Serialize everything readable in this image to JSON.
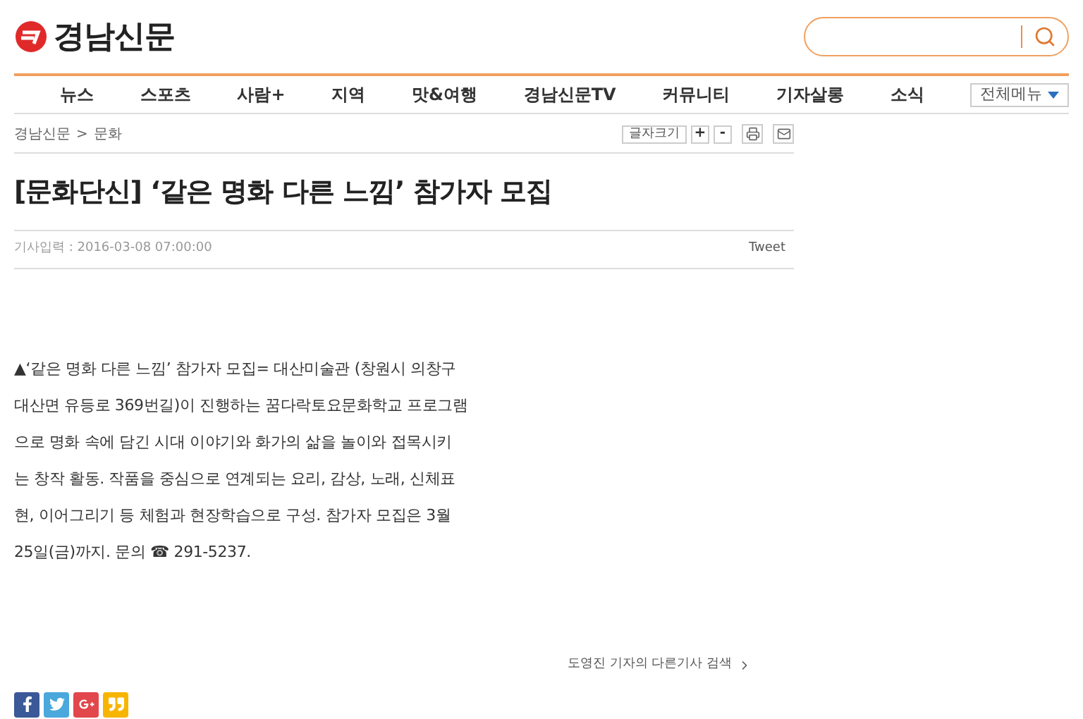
{
  "logo": {
    "text": "경남신문"
  },
  "nav": [
    "뉴스",
    "스포츠",
    "사람+",
    "지역",
    "맛&여행",
    "경남신문TV",
    "커뮤니티",
    "기자살롱",
    "소식"
  ],
  "all_menu": "전체메뉴",
  "breadcrumb": [
    "경남신문",
    "문화"
  ],
  "breadcrumb_separator": ">",
  "font_size": {
    "label": "글자크기",
    "increase": "+",
    "decrease": "-"
  },
  "headline": "[문화단신] ‘같은 명화 다른 느낌’ 참가자 모집",
  "date": "기사입력 : 2016-03-08 07:00:00",
  "tweet": "Tweet",
  "body_lines": [
    "▲‘같은 명화 다른 느낌’ 참가자 모집= 대산미술관 (창원시 의창구",
    "대산면 유등로 369번길)이 진행하는 꿈다락토요문화학교 프로그램",
    "으로 명화 속에 담긴 시대 이야기와 화가의 삶을 놀이와 접목시키",
    "는 창작 활동. 작품을 중심으로 연계되는 요리, 감상, 노래, 신체표",
    "현, 이어그리기 등 체험과 현장학습으로 구성. 참가자 모집은 3월",
    "25일(금)까지. 문의 ☎ 291-5237."
  ],
  "reporter_link": "도영진 기자의 다른기사 검색",
  "share": [
    {
      "kind": "facebook",
      "color": "#3b5998"
    },
    {
      "kind": "twitter",
      "color": "#4aa8dc"
    },
    {
      "kind": "google",
      "color": "#e2474b"
    },
    {
      "kind": "kakaostory",
      "color": "#f7b500"
    }
  ]
}
